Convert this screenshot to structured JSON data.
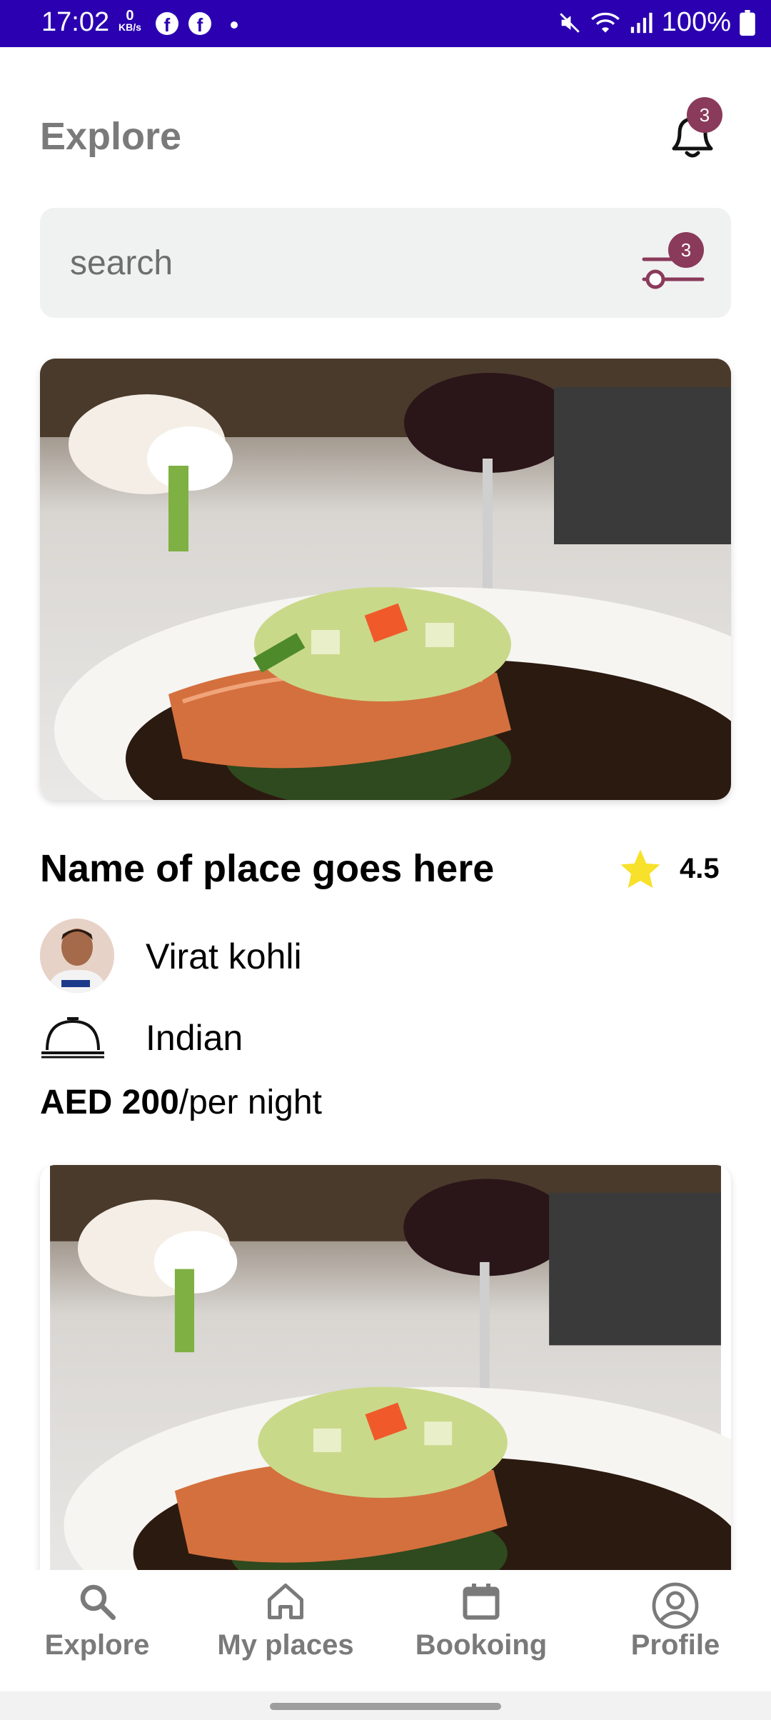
{
  "status_bar": {
    "time": "17:02",
    "net_speed_value": "0",
    "net_speed_unit": "KB/s",
    "battery": "100%"
  },
  "header": {
    "title": "Explore",
    "notification_count": "3"
  },
  "search": {
    "placeholder": "search",
    "filter_count": "3"
  },
  "listing": {
    "name": "Name of place goes here",
    "rating": "4.5",
    "host": "Virat kohli",
    "cuisine": "Indian",
    "price_amount": "AED 200",
    "price_unit": "/per night"
  },
  "bottom_nav": {
    "items": [
      {
        "label": "Explore",
        "icon": "search-icon"
      },
      {
        "label": "My places",
        "icon": "home-icon"
      },
      {
        "label": "Bookoing",
        "icon": "calendar-icon"
      },
      {
        "label": "Profile",
        "icon": "profile-icon"
      }
    ]
  },
  "colors": {
    "status_bar": "#2a00b0",
    "badge": "#8a3a5a",
    "star": "#f7e12a",
    "nav_text": "#7a7a7a"
  }
}
